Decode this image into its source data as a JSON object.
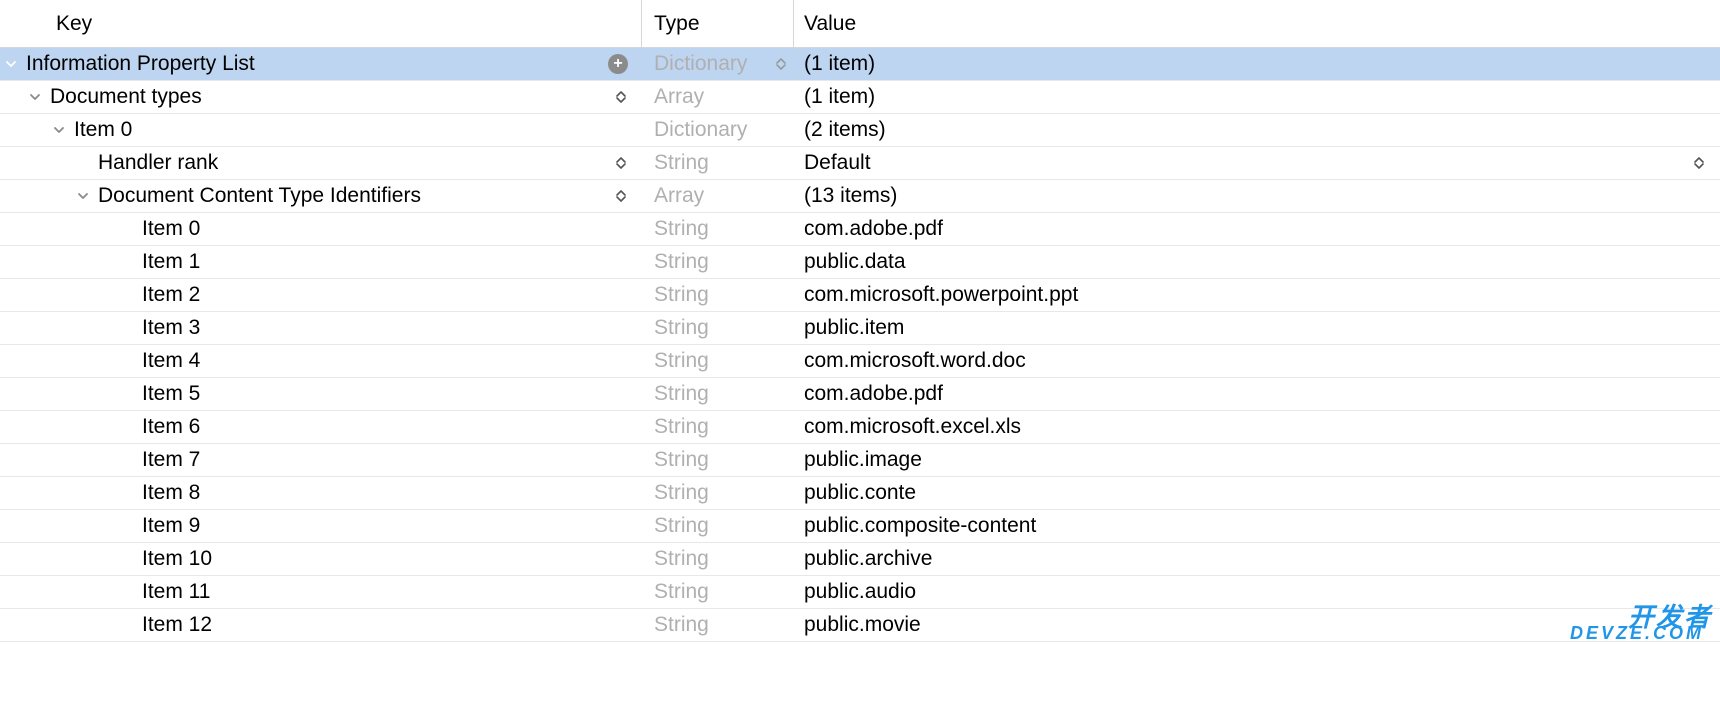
{
  "headers": {
    "key": "Key",
    "type": "Type",
    "value": "Value"
  },
  "rows": [
    {
      "indent": 0,
      "hasDisclosure": true,
      "open": true,
      "selected": true,
      "key": "Information Property List",
      "type": "Dictionary",
      "value": "(1 item)",
      "hasAdd": true,
      "hasKeyUpDown": false,
      "hasTypeUpDown": true,
      "hasValueUpDown": false
    },
    {
      "indent": 1,
      "hasDisclosure": true,
      "open": true,
      "selected": false,
      "key": "Document types",
      "type": "Array",
      "value": "(1 item)",
      "hasAdd": false,
      "hasKeyUpDown": true,
      "hasTypeUpDown": false,
      "hasValueUpDown": false
    },
    {
      "indent": 2,
      "hasDisclosure": true,
      "open": true,
      "selected": false,
      "key": "Item 0",
      "type": "Dictionary",
      "value": "(2 items)",
      "hasAdd": false,
      "hasKeyUpDown": false,
      "hasTypeUpDown": false,
      "hasValueUpDown": false
    },
    {
      "indent": 3,
      "hasDisclosure": false,
      "open": false,
      "selected": false,
      "key": "Handler rank",
      "type": "String",
      "value": "Default",
      "hasAdd": false,
      "hasKeyUpDown": true,
      "hasTypeUpDown": false,
      "hasValueUpDown": true
    },
    {
      "indent": 3,
      "hasDisclosure": true,
      "open": true,
      "selected": false,
      "key": "Document Content Type Identifiers",
      "type": "Array",
      "value": "(13 items)",
      "hasAdd": false,
      "hasKeyUpDown": true,
      "hasTypeUpDown": false,
      "hasValueUpDown": false
    },
    {
      "indent": 4,
      "hasDisclosure": false,
      "open": false,
      "selected": false,
      "key": "Item 0",
      "type": "String",
      "value": "com.adobe.pdf",
      "hasAdd": false,
      "hasKeyUpDown": false,
      "hasTypeUpDown": false,
      "hasValueUpDown": false
    },
    {
      "indent": 4,
      "hasDisclosure": false,
      "open": false,
      "selected": false,
      "key": "Item 1",
      "type": "String",
      "value": "public.data",
      "hasAdd": false,
      "hasKeyUpDown": false,
      "hasTypeUpDown": false,
      "hasValueUpDown": false
    },
    {
      "indent": 4,
      "hasDisclosure": false,
      "open": false,
      "selected": false,
      "key": "Item 2",
      "type": "String",
      "value": "com.microsoft.powerpoint.ppt",
      "hasAdd": false,
      "hasKeyUpDown": false,
      "hasTypeUpDown": false,
      "hasValueUpDown": false
    },
    {
      "indent": 4,
      "hasDisclosure": false,
      "open": false,
      "selected": false,
      "key": "Item 3",
      "type": "String",
      "value": "public.item",
      "hasAdd": false,
      "hasKeyUpDown": false,
      "hasTypeUpDown": false,
      "hasValueUpDown": false
    },
    {
      "indent": 4,
      "hasDisclosure": false,
      "open": false,
      "selected": false,
      "key": "Item 4",
      "type": "String",
      "value": "com.microsoft.word.doc",
      "hasAdd": false,
      "hasKeyUpDown": false,
      "hasTypeUpDown": false,
      "hasValueUpDown": false
    },
    {
      "indent": 4,
      "hasDisclosure": false,
      "open": false,
      "selected": false,
      "key": "Item 5",
      "type": "String",
      "value": "com.adobe.pdf",
      "hasAdd": false,
      "hasKeyUpDown": false,
      "hasTypeUpDown": false,
      "hasValueUpDown": false
    },
    {
      "indent": 4,
      "hasDisclosure": false,
      "open": false,
      "selected": false,
      "key": "Item 6",
      "type": "String",
      "value": "com.microsoft.excel.xls",
      "hasAdd": false,
      "hasKeyUpDown": false,
      "hasTypeUpDown": false,
      "hasValueUpDown": false
    },
    {
      "indent": 4,
      "hasDisclosure": false,
      "open": false,
      "selected": false,
      "key": "Item 7",
      "type": "String",
      "value": "public.image",
      "hasAdd": false,
      "hasKeyUpDown": false,
      "hasTypeUpDown": false,
      "hasValueUpDown": false
    },
    {
      "indent": 4,
      "hasDisclosure": false,
      "open": false,
      "selected": false,
      "key": "Item 8",
      "type": "String",
      "value": "public.conte",
      "hasAdd": false,
      "hasKeyUpDown": false,
      "hasTypeUpDown": false,
      "hasValueUpDown": false
    },
    {
      "indent": 4,
      "hasDisclosure": false,
      "open": false,
      "selected": false,
      "key": "Item 9",
      "type": "String",
      "value": "public.composite-content",
      "hasAdd": false,
      "hasKeyUpDown": false,
      "hasTypeUpDown": false,
      "hasValueUpDown": false
    },
    {
      "indent": 4,
      "hasDisclosure": false,
      "open": false,
      "selected": false,
      "key": "Item 10",
      "type": "String",
      "value": "public.archive",
      "hasAdd": false,
      "hasKeyUpDown": false,
      "hasTypeUpDown": false,
      "hasValueUpDown": false
    },
    {
      "indent": 4,
      "hasDisclosure": false,
      "open": false,
      "selected": false,
      "key": "Item 11",
      "type": "String",
      "value": "public.audio",
      "hasAdd": false,
      "hasKeyUpDown": false,
      "hasTypeUpDown": false,
      "hasValueUpDown": false
    },
    {
      "indent": 4,
      "hasDisclosure": false,
      "open": false,
      "selected": false,
      "key": "Item 12",
      "type": "String",
      "value": "public.movie",
      "hasAdd": false,
      "hasKeyUpDown": false,
      "hasTypeUpDown": false,
      "hasValueUpDown": false
    }
  ],
  "watermark": {
    "top": "开发者",
    "bottom": "DEVZE.COM"
  }
}
